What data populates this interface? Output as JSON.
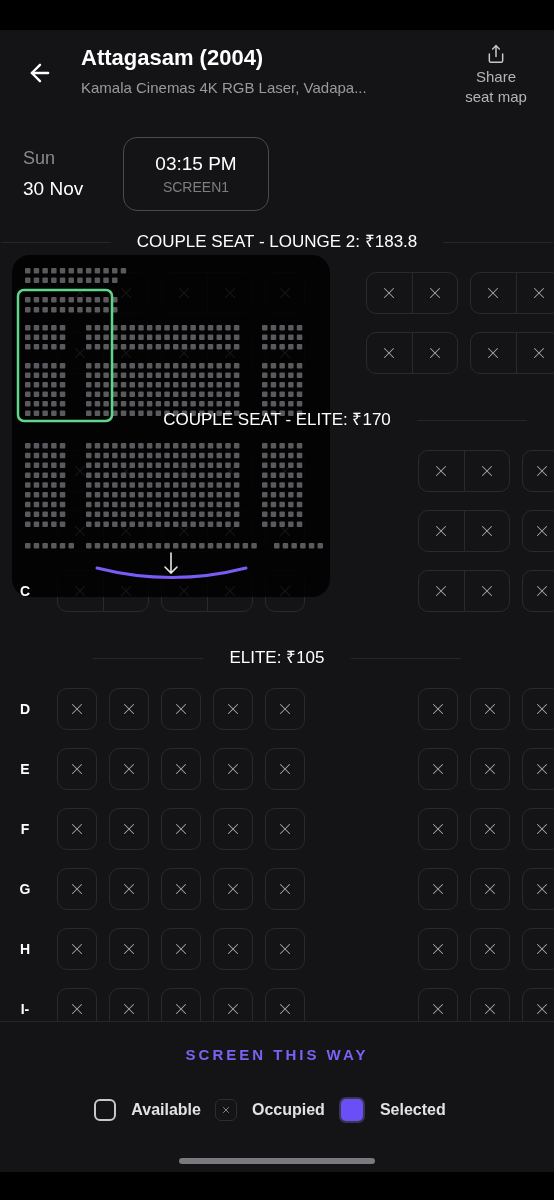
{
  "header": {
    "title": "Attagasam (2004)",
    "subtitle": "Kamala Cinemas 4K RGB Laser, Vadapa...",
    "share_label": "Share seat map"
  },
  "show": {
    "day": "Sun",
    "date": "30 Nov",
    "times": [
      {
        "time": "03:15 PM",
        "screen": "SCREEN1",
        "selected": true
      }
    ]
  },
  "sections": [
    {
      "title": "COUPLE SEAT - LOUNGE 2: ₹183.8",
      "rows": [
        {
          "blocks": [
            [
              {
                "kind": "couple",
                "occupied": true
              },
              {
                "kind": "couple",
                "occupied": true
              },
              {
                "kind": "single",
                "occupied": true
              }
            ],
            [
              {
                "kind": "couple",
                "occupied": true
              },
              {
                "kind": "couple",
                "occupied": true
              }
            ]
          ]
        },
        {
          "blocks": [
            [
              {
                "kind": "couple",
                "occupied": true
              },
              {
                "kind": "couple",
                "occupied": true
              },
              {
                "kind": "single",
                "occupied": true
              }
            ],
            [
              {
                "kind": "couple",
                "occupied": true
              },
              {
                "kind": "couple",
                "occupied": true
              }
            ]
          ]
        }
      ]
    },
    {
      "title": "COUPLE SEAT - ELITE: ₹170",
      "rows": [
        {
          "blocks": [
            [
              {
                "kind": "couple",
                "occupied": true
              },
              {
                "kind": "couple",
                "occupied": true
              },
              {
                "kind": "single",
                "occupied": true
              }
            ],
            [
              {
                "kind": "couple",
                "occupied": true
              },
              {
                "kind": "single",
                "occupied": true
              }
            ]
          ]
        },
        {
          "blocks": [
            [
              {
                "kind": "couple",
                "occupied": true
              },
              {
                "kind": "couple",
                "occupied": true
              },
              {
                "kind": "single",
                "occupied": true
              }
            ],
            [
              {
                "kind": "couple",
                "occupied": true
              },
              {
                "kind": "single",
                "occupied": true
              }
            ]
          ]
        },
        {
          "label": "C",
          "blocks": [
            [
              {
                "kind": "couple",
                "occupied": true
              },
              {
                "kind": "couple",
                "occupied": true
              },
              {
                "kind": "single",
                "occupied": true
              }
            ],
            [
              {
                "kind": "couple",
                "occupied": true
              },
              {
                "kind": "single",
                "occupied": true
              }
            ]
          ]
        }
      ]
    },
    {
      "title": "ELITE: ₹105",
      "rows": [
        {
          "label": "D",
          "blocks": [
            [
              {
                "kind": "single",
                "occupied": true
              },
              {
                "kind": "single",
                "occupied": true
              },
              {
                "kind": "single",
                "occupied": true
              },
              {
                "kind": "single",
                "occupied": true
              },
              {
                "kind": "single",
                "occupied": true
              }
            ],
            [
              {
                "kind": "single",
                "occupied": true
              },
              {
                "kind": "single",
                "occupied": true
              },
              {
                "kind": "single",
                "occupied": true
              }
            ]
          ]
        },
        {
          "label": "E",
          "blocks": [
            [
              {
                "kind": "single",
                "occupied": true
              },
              {
                "kind": "single",
                "occupied": true
              },
              {
                "kind": "single",
                "occupied": true
              },
              {
                "kind": "single",
                "occupied": true
              },
              {
                "kind": "single",
                "occupied": true
              }
            ],
            [
              {
                "kind": "single",
                "occupied": true
              },
              {
                "kind": "single",
                "occupied": true
              },
              {
                "kind": "single",
                "occupied": true
              }
            ]
          ]
        },
        {
          "label": "F",
          "blocks": [
            [
              {
                "kind": "single",
                "occupied": true
              },
              {
                "kind": "single",
                "occupied": true
              },
              {
                "kind": "single",
                "occupied": true
              },
              {
                "kind": "single",
                "occupied": true
              },
              {
                "kind": "single",
                "occupied": true
              }
            ],
            [
              {
                "kind": "single",
                "occupied": true
              },
              {
                "kind": "single",
                "occupied": true
              },
              {
                "kind": "single",
                "occupied": true
              }
            ]
          ]
        },
        {
          "label": "G",
          "blocks": [
            [
              {
                "kind": "single",
                "occupied": true
              },
              {
                "kind": "single",
                "occupied": true
              },
              {
                "kind": "single",
                "occupied": true
              },
              {
                "kind": "single",
                "occupied": true
              },
              {
                "kind": "single",
                "occupied": true
              }
            ],
            [
              {
                "kind": "single",
                "occupied": true
              },
              {
                "kind": "single",
                "occupied": true
              },
              {
                "kind": "single",
                "occupied": true
              }
            ]
          ]
        },
        {
          "label": "H",
          "blocks": [
            [
              {
                "kind": "single",
                "occupied": true
              },
              {
                "kind": "single",
                "occupied": true
              },
              {
                "kind": "single",
                "occupied": true
              },
              {
                "kind": "single",
                "occupied": true
              },
              {
                "kind": "single",
                "occupied": true
              }
            ],
            [
              {
                "kind": "single",
                "occupied": true
              },
              {
                "kind": "single",
                "occupied": true
              },
              {
                "kind": "single",
                "occupied": true
              }
            ]
          ]
        },
        {
          "label": "I-",
          "blocks": [
            [
              {
                "kind": "single",
                "occupied": true
              },
              {
                "kind": "single",
                "occupied": true
              },
              {
                "kind": "single",
                "occupied": true
              },
              {
                "kind": "single",
                "occupied": true
              },
              {
                "kind": "single",
                "occupied": true
              }
            ],
            [
              {
                "kind": "single",
                "occupied": true
              },
              {
                "kind": "single",
                "occupied": true
              },
              {
                "kind": "single",
                "occupied": true
              }
            ]
          ]
        }
      ]
    }
  ],
  "footer": {
    "screen_label": "SCREEN THIS WAY",
    "legend": [
      {
        "kind": "available",
        "label": "Available"
      },
      {
        "kind": "occupied",
        "label": "Occupied"
      },
      {
        "kind": "selected",
        "label": "Selected"
      }
    ]
  }
}
